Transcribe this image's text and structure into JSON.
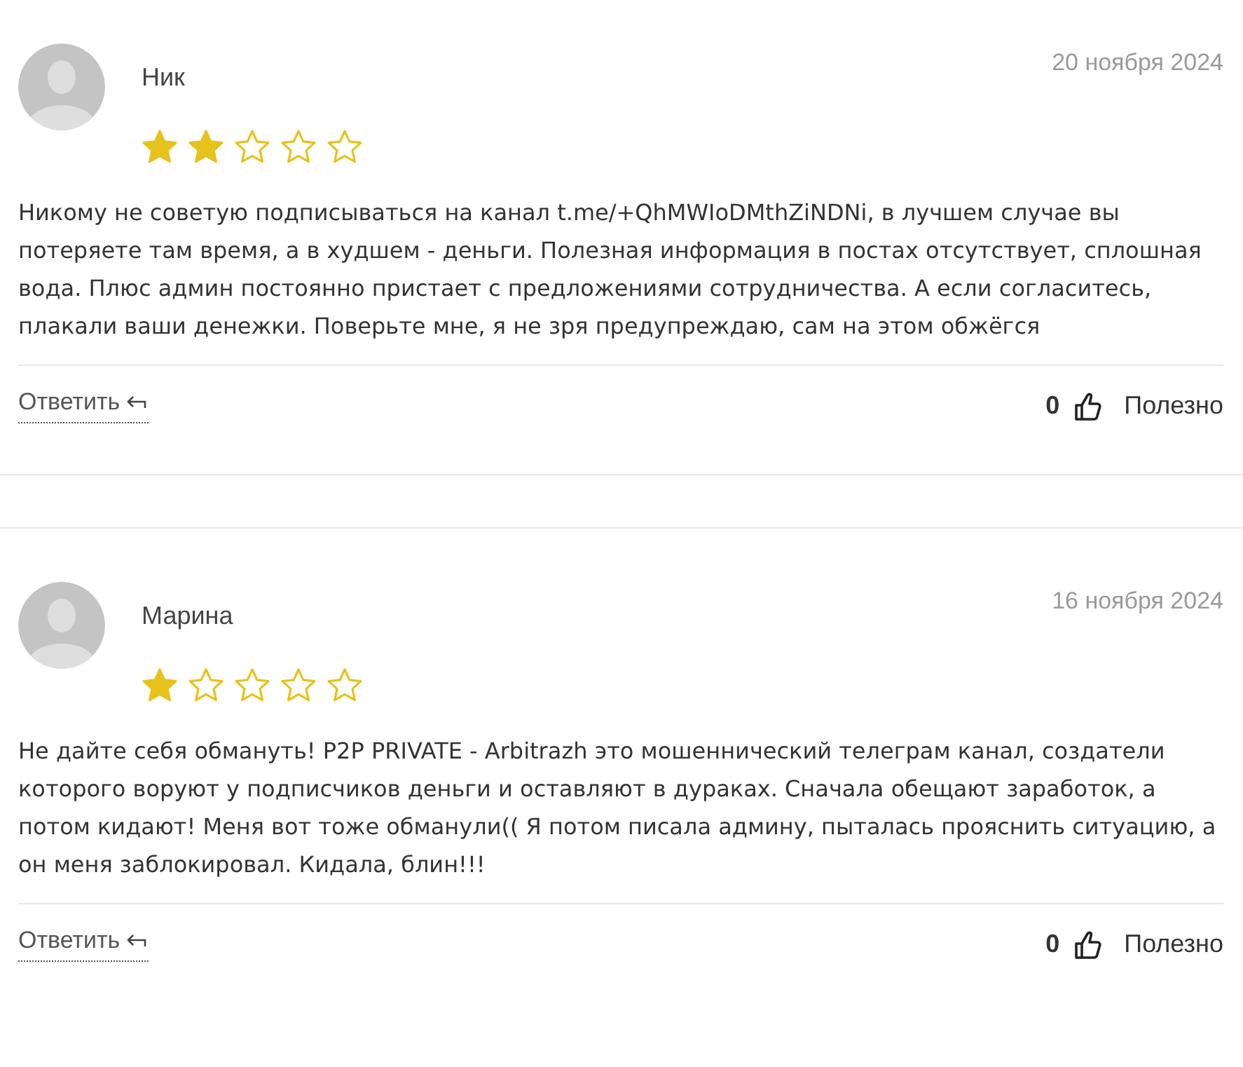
{
  "reviews": [
    {
      "author": "Ник",
      "date": "20 ноября 2024",
      "stars": 2,
      "text": "Никому не советую подписываться на канал t.me/+QhMWIoDMthZiNDNi, в лучшем случае вы потеряете там время, а в худшем - деньги. Полезная информация в постах отсутствует, сплошная вода. Плюс админ постоянно пристает с предложениями сотрудничества. А если согласитесь, плакали ваши денежки. Поверьте мне, я не зря предупреждаю, сам на этом обжёгся",
      "reply": "Ответить",
      "likes": "0",
      "useful": "Полезно"
    },
    {
      "author": "Марина",
      "date": "16 ноября 2024",
      "stars": 1,
      "text": "Не дайте себя обмануть! P2P PRIVATE - Arbitrazh это мошеннический телеграм канал, создатели которого воруют у подписчиков деньги и оставляют в дураках. Сначала обещают заработок, а потом кидают! Меня вот тоже обманули(( Я потом писала админу, пыталась прояснить ситуацию, а он меня заблокировал. Кидала, блин!!!",
      "reply": "Ответить",
      "likes": "0",
      "useful": "Полезно"
    }
  ]
}
